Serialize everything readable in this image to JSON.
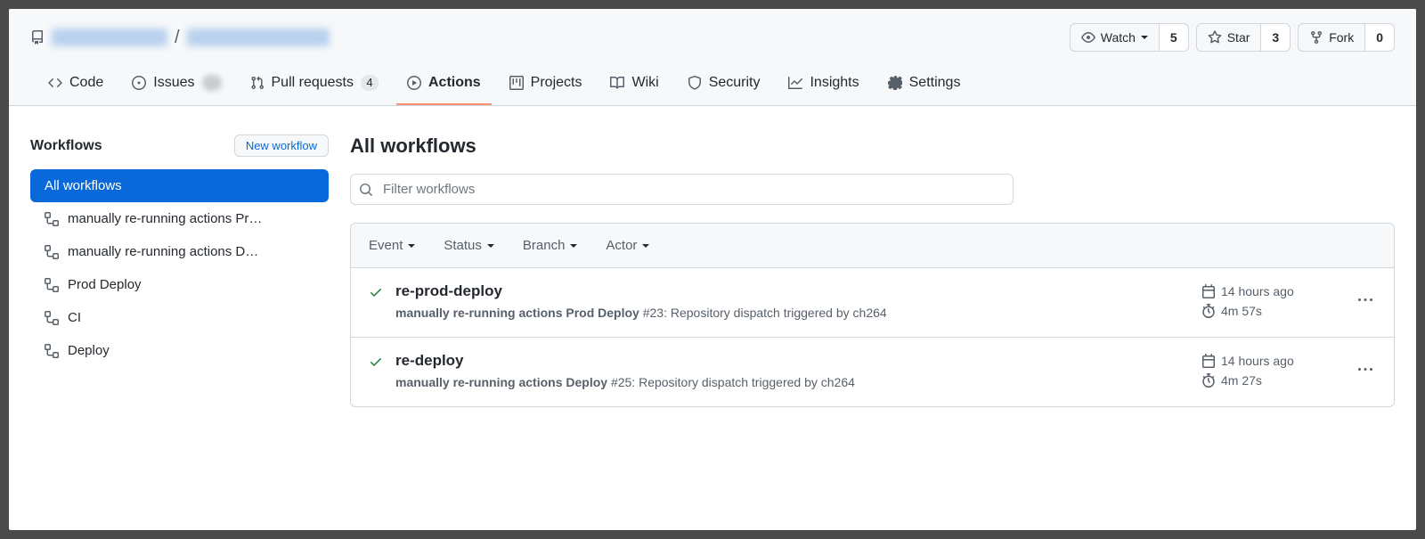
{
  "repo": {
    "owner": "████████",
    "name": "█████████████",
    "buttons": {
      "watch": {
        "label": "Watch",
        "count": "5"
      },
      "star": {
        "label": "Star",
        "count": "3"
      },
      "fork": {
        "label": "Fork",
        "count": "0"
      }
    }
  },
  "nav": {
    "code": "Code",
    "issues": "Issues",
    "issues_count": "",
    "pulls": "Pull requests",
    "pulls_count": "4",
    "actions": "Actions",
    "projects": "Projects",
    "wiki": "Wiki",
    "security": "Security",
    "insights": "Insights",
    "settings": "Settings"
  },
  "sidebar": {
    "heading": "Workflows",
    "new_button": "New workflow",
    "items": [
      {
        "label": "All workflows"
      },
      {
        "label": "manually re-running actions Pr…"
      },
      {
        "label": "manually re-running actions D…"
      },
      {
        "label": "Prod Deploy"
      },
      {
        "label": "CI"
      },
      {
        "label": "Deploy"
      }
    ]
  },
  "content": {
    "title": "All workflows",
    "search_placeholder": "Filter workflows"
  },
  "filters": {
    "event": "Event",
    "status": "Status",
    "branch": "Branch",
    "actor": "Actor"
  },
  "runs": [
    {
      "title": "re-prod-deploy",
      "workflow": "manually re-running actions Prod Deploy",
      "run_number": "#23",
      "trigger": "Repository dispatch triggered by",
      "actor": "ch264",
      "time_ago": "14 hours ago",
      "duration": "4m 57s"
    },
    {
      "title": "re-deploy",
      "workflow": "manually re-running actions Deploy",
      "run_number": "#25",
      "trigger": "Repository dispatch triggered by",
      "actor": "ch264",
      "time_ago": "14 hours ago",
      "duration": "4m 27s"
    }
  ]
}
